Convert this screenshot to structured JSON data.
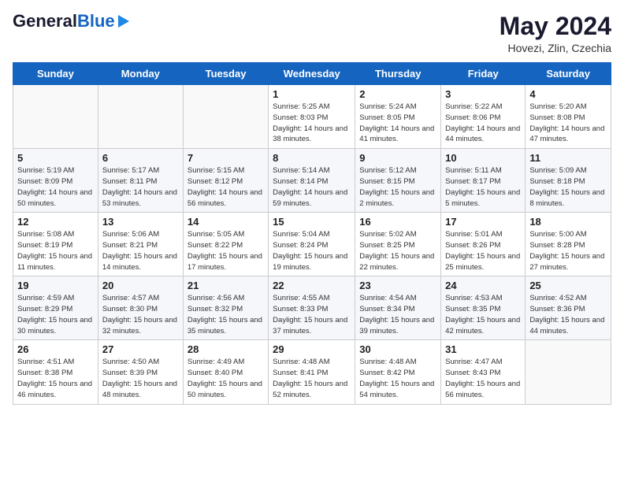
{
  "header": {
    "logo_general": "General",
    "logo_blue": "Blue",
    "month_year": "May 2024",
    "location": "Hovezi, Zlin, Czechia"
  },
  "weekdays": [
    "Sunday",
    "Monday",
    "Tuesday",
    "Wednesday",
    "Thursday",
    "Friday",
    "Saturday"
  ],
  "weeks": [
    [
      {
        "day": "",
        "sunrise": "",
        "sunset": "",
        "daylight": ""
      },
      {
        "day": "",
        "sunrise": "",
        "sunset": "",
        "daylight": ""
      },
      {
        "day": "",
        "sunrise": "",
        "sunset": "",
        "daylight": ""
      },
      {
        "day": "1",
        "sunrise": "Sunrise: 5:25 AM",
        "sunset": "Sunset: 8:03 PM",
        "daylight": "Daylight: 14 hours and 38 minutes."
      },
      {
        "day": "2",
        "sunrise": "Sunrise: 5:24 AM",
        "sunset": "Sunset: 8:05 PM",
        "daylight": "Daylight: 14 hours and 41 minutes."
      },
      {
        "day": "3",
        "sunrise": "Sunrise: 5:22 AM",
        "sunset": "Sunset: 8:06 PM",
        "daylight": "Daylight: 14 hours and 44 minutes."
      },
      {
        "day": "4",
        "sunrise": "Sunrise: 5:20 AM",
        "sunset": "Sunset: 8:08 PM",
        "daylight": "Daylight: 14 hours and 47 minutes."
      }
    ],
    [
      {
        "day": "5",
        "sunrise": "Sunrise: 5:19 AM",
        "sunset": "Sunset: 8:09 PM",
        "daylight": "Daylight: 14 hours and 50 minutes."
      },
      {
        "day": "6",
        "sunrise": "Sunrise: 5:17 AM",
        "sunset": "Sunset: 8:11 PM",
        "daylight": "Daylight: 14 hours and 53 minutes."
      },
      {
        "day": "7",
        "sunrise": "Sunrise: 5:15 AM",
        "sunset": "Sunset: 8:12 PM",
        "daylight": "Daylight: 14 hours and 56 minutes."
      },
      {
        "day": "8",
        "sunrise": "Sunrise: 5:14 AM",
        "sunset": "Sunset: 8:14 PM",
        "daylight": "Daylight: 14 hours and 59 minutes."
      },
      {
        "day": "9",
        "sunrise": "Sunrise: 5:12 AM",
        "sunset": "Sunset: 8:15 PM",
        "daylight": "Daylight: 15 hours and 2 minutes."
      },
      {
        "day": "10",
        "sunrise": "Sunrise: 5:11 AM",
        "sunset": "Sunset: 8:17 PM",
        "daylight": "Daylight: 15 hours and 5 minutes."
      },
      {
        "day": "11",
        "sunrise": "Sunrise: 5:09 AM",
        "sunset": "Sunset: 8:18 PM",
        "daylight": "Daylight: 15 hours and 8 minutes."
      }
    ],
    [
      {
        "day": "12",
        "sunrise": "Sunrise: 5:08 AM",
        "sunset": "Sunset: 8:19 PM",
        "daylight": "Daylight: 15 hours and 11 minutes."
      },
      {
        "day": "13",
        "sunrise": "Sunrise: 5:06 AM",
        "sunset": "Sunset: 8:21 PM",
        "daylight": "Daylight: 15 hours and 14 minutes."
      },
      {
        "day": "14",
        "sunrise": "Sunrise: 5:05 AM",
        "sunset": "Sunset: 8:22 PM",
        "daylight": "Daylight: 15 hours and 17 minutes."
      },
      {
        "day": "15",
        "sunrise": "Sunrise: 5:04 AM",
        "sunset": "Sunset: 8:24 PM",
        "daylight": "Daylight: 15 hours and 19 minutes."
      },
      {
        "day": "16",
        "sunrise": "Sunrise: 5:02 AM",
        "sunset": "Sunset: 8:25 PM",
        "daylight": "Daylight: 15 hours and 22 minutes."
      },
      {
        "day": "17",
        "sunrise": "Sunrise: 5:01 AM",
        "sunset": "Sunset: 8:26 PM",
        "daylight": "Daylight: 15 hours and 25 minutes."
      },
      {
        "day": "18",
        "sunrise": "Sunrise: 5:00 AM",
        "sunset": "Sunset: 8:28 PM",
        "daylight": "Daylight: 15 hours and 27 minutes."
      }
    ],
    [
      {
        "day": "19",
        "sunrise": "Sunrise: 4:59 AM",
        "sunset": "Sunset: 8:29 PM",
        "daylight": "Daylight: 15 hours and 30 minutes."
      },
      {
        "day": "20",
        "sunrise": "Sunrise: 4:57 AM",
        "sunset": "Sunset: 8:30 PM",
        "daylight": "Daylight: 15 hours and 32 minutes."
      },
      {
        "day": "21",
        "sunrise": "Sunrise: 4:56 AM",
        "sunset": "Sunset: 8:32 PM",
        "daylight": "Daylight: 15 hours and 35 minutes."
      },
      {
        "day": "22",
        "sunrise": "Sunrise: 4:55 AM",
        "sunset": "Sunset: 8:33 PM",
        "daylight": "Daylight: 15 hours and 37 minutes."
      },
      {
        "day": "23",
        "sunrise": "Sunrise: 4:54 AM",
        "sunset": "Sunset: 8:34 PM",
        "daylight": "Daylight: 15 hours and 39 minutes."
      },
      {
        "day": "24",
        "sunrise": "Sunrise: 4:53 AM",
        "sunset": "Sunset: 8:35 PM",
        "daylight": "Daylight: 15 hours and 42 minutes."
      },
      {
        "day": "25",
        "sunrise": "Sunrise: 4:52 AM",
        "sunset": "Sunset: 8:36 PM",
        "daylight": "Daylight: 15 hours and 44 minutes."
      }
    ],
    [
      {
        "day": "26",
        "sunrise": "Sunrise: 4:51 AM",
        "sunset": "Sunset: 8:38 PM",
        "daylight": "Daylight: 15 hours and 46 minutes."
      },
      {
        "day": "27",
        "sunrise": "Sunrise: 4:50 AM",
        "sunset": "Sunset: 8:39 PM",
        "daylight": "Daylight: 15 hours and 48 minutes."
      },
      {
        "day": "28",
        "sunrise": "Sunrise: 4:49 AM",
        "sunset": "Sunset: 8:40 PM",
        "daylight": "Daylight: 15 hours and 50 minutes."
      },
      {
        "day": "29",
        "sunrise": "Sunrise: 4:48 AM",
        "sunset": "Sunset: 8:41 PM",
        "daylight": "Daylight: 15 hours and 52 minutes."
      },
      {
        "day": "30",
        "sunrise": "Sunrise: 4:48 AM",
        "sunset": "Sunset: 8:42 PM",
        "daylight": "Daylight: 15 hours and 54 minutes."
      },
      {
        "day": "31",
        "sunrise": "Sunrise: 4:47 AM",
        "sunset": "Sunset: 8:43 PM",
        "daylight": "Daylight: 15 hours and 56 minutes."
      },
      {
        "day": "",
        "sunrise": "",
        "sunset": "",
        "daylight": ""
      }
    ]
  ]
}
